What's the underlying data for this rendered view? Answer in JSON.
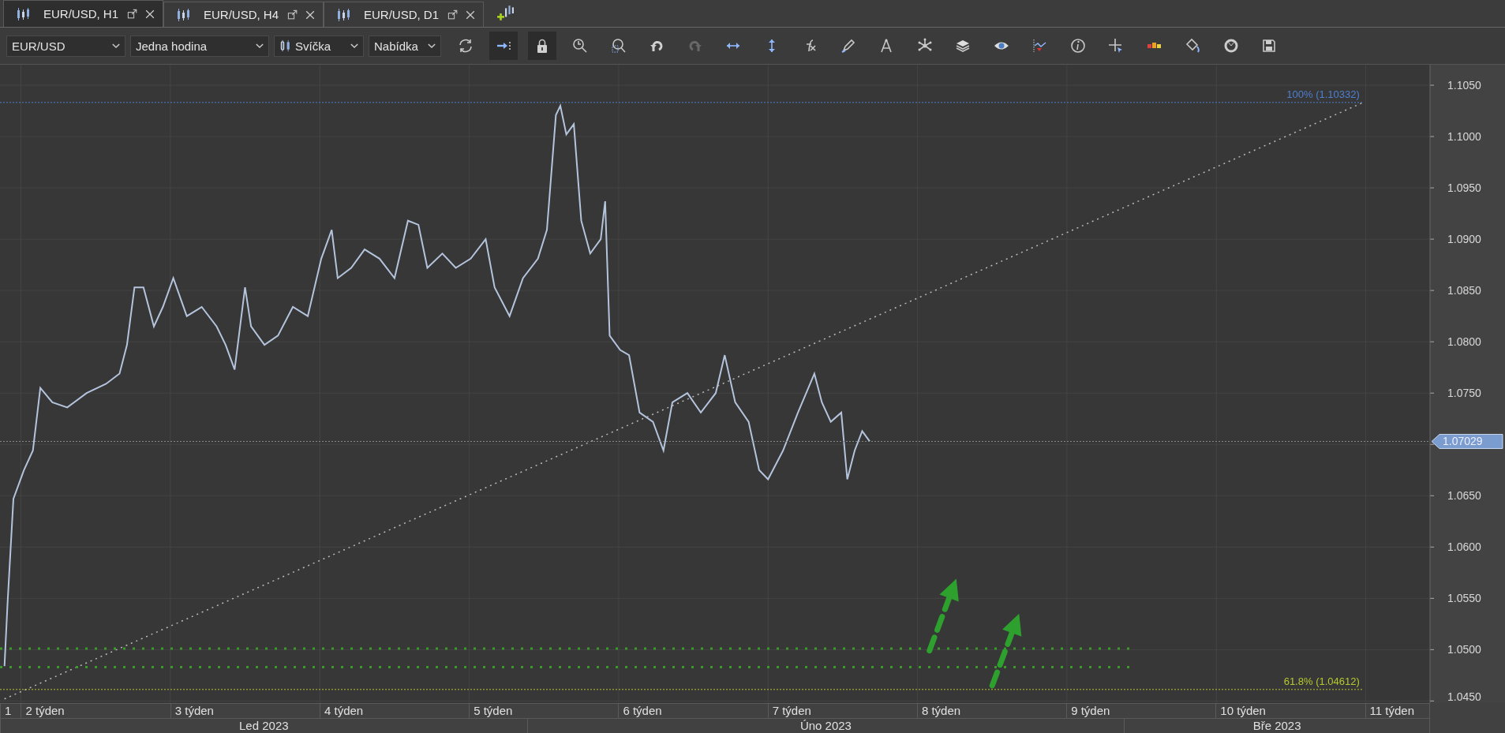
{
  "tabs": [
    {
      "label": "EUR/USD, H1",
      "selected": true
    },
    {
      "label": "EUR/USD, H4",
      "selected": false
    },
    {
      "label": "EUR/USD, D1",
      "selected": false
    }
  ],
  "toolbar": {
    "symbol": "EUR/USD",
    "period": "Jedna hodina",
    "chart_type": "Svíčka",
    "price_side": "Nabídka",
    "buttons": [
      {
        "pressed": false,
        "disabled": false
      },
      {
        "pressed": true,
        "disabled": false
      },
      {
        "pressed": true,
        "disabled": false
      },
      {
        "pressed": false,
        "disabled": false
      },
      {
        "pressed": false,
        "disabled": false
      },
      {
        "pressed": false,
        "disabled": false
      },
      {
        "pressed": false,
        "disabled": true
      },
      {
        "pressed": false,
        "disabled": false
      },
      {
        "pressed": false,
        "disabled": false
      },
      {
        "pressed": false,
        "disabled": false
      },
      {
        "pressed": false,
        "disabled": false
      },
      {
        "pressed": false,
        "disabled": false
      },
      {
        "pressed": false,
        "disabled": false
      },
      {
        "pressed": false,
        "disabled": false
      },
      {
        "pressed": false,
        "disabled": false
      },
      {
        "pressed": false,
        "disabled": false
      },
      {
        "pressed": false,
        "disabled": false
      },
      {
        "pressed": false,
        "disabled": false
      },
      {
        "pressed": false,
        "disabled": false
      },
      {
        "pressed": false,
        "disabled": false
      },
      {
        "pressed": false,
        "disabled": false
      },
      {
        "pressed": false,
        "disabled": false
      }
    ]
  },
  "chart": {
    "price_labels": [
      "1.1050",
      "1.1000",
      "1.0950",
      "1.0900",
      "1.0850",
      "1.0800",
      "1.0750",
      "1.0650",
      "1.0600",
      "1.0550",
      "1.0500",
      "1.0450"
    ],
    "price_tag": "1.07029",
    "fibonacci_labels": [
      "100% (1.10332)",
      "61.8% (1.04612)"
    ],
    "week_labels": [
      "1",
      "2 týden",
      "3 týden",
      "4 týden",
      "5 týden",
      "6 týden",
      "7 týden",
      "8 týden",
      "9 týden",
      "10 týden",
      "11 týden"
    ],
    "months": [
      "Led 2023",
      "Úno 2023",
      "Bře 2023"
    ]
  }
}
